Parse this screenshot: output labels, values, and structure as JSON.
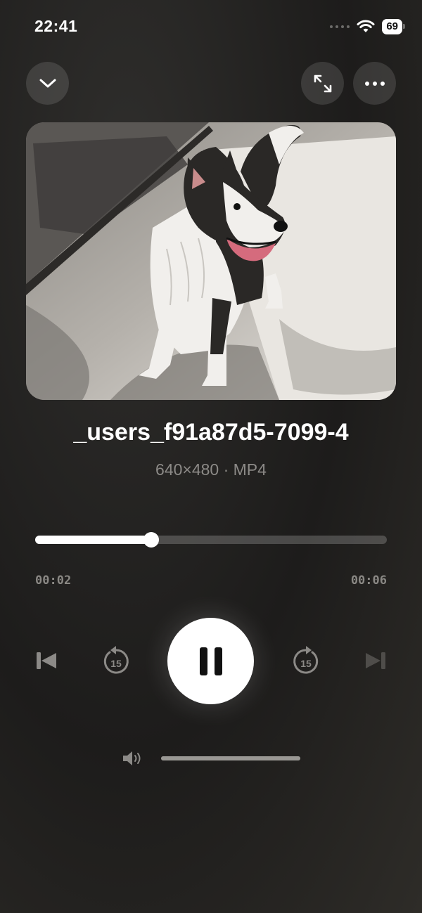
{
  "status_bar": {
    "time": "22:41",
    "battery": "69"
  },
  "header": {
    "collapse_icon": "chevron-down-icon",
    "fullscreen_icon": "expand-arrows-icon",
    "more_icon": "ellipsis-icon"
  },
  "media": {
    "artwork_description_icon": "artwork-image",
    "title": "_users_f91a87d5-7099-4",
    "meta": "640×480 · MP4"
  },
  "playback": {
    "progress_fraction": 0.33,
    "elapsed": "00:02",
    "duration": "00:06",
    "skip_back_seconds": "15",
    "skip_forward_seconds": "15",
    "volume_fraction": 1.0
  },
  "colors": {
    "background": "#232220",
    "accent": "#ffffff",
    "muted_text": "#8c8a87"
  }
}
